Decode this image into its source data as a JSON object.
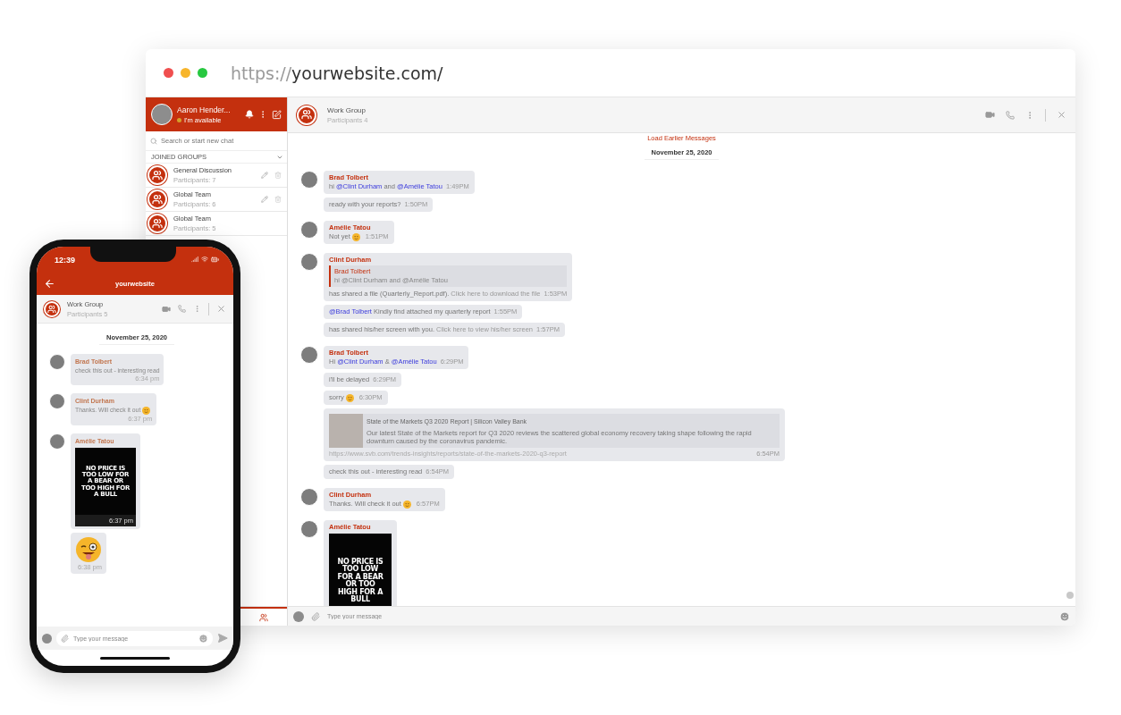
{
  "browser": {
    "url_scheme": "https://",
    "url_host": "yourwebsite.com/"
  },
  "sidebar": {
    "user": {
      "name": "Aaron Hender...",
      "status": "I'm available"
    },
    "search": {
      "placeholder": "Search or start new chat"
    },
    "section": "JOINED GROUPS",
    "groups": [
      {
        "name": "General Discussion",
        "participants": "Participants: 7",
        "editable": true
      },
      {
        "name": "Global Team",
        "participants": "Participants: 6",
        "editable": true
      },
      {
        "name": "Global Team",
        "participants": "Participants: 5",
        "editable": false
      }
    ],
    "tabs": [
      {
        "kind": "contacts",
        "selected": true
      }
    ]
  },
  "chat": {
    "title": "Work Group",
    "participants": "Participants 4",
    "load_more": "Load Earlier Messages",
    "date": "November 25, 2020",
    "messages": [
      {
        "sender": "Brad Tolbert",
        "bubbles": [
          {
            "kind": "text",
            "parts": [
              {
                "kind": "text",
                "text": "hi"
              },
              {
                "kind": "mention",
                "text": "@Clint Durham"
              },
              {
                "kind": "text",
                "text": "and"
              },
              {
                "kind": "mention",
                "text": "@Amélie Tatou"
              }
            ],
            "time": "1:49PM"
          },
          {
            "kind": "text",
            "parts": [
              {
                "kind": "text",
                "text": "ready with your reports?"
              }
            ],
            "time": "1:50PM"
          }
        ]
      },
      {
        "sender": "Amélie Tatou",
        "bubbles": [
          {
            "kind": "text",
            "parts": [
              {
                "kind": "text",
                "text": "Not yet"
              },
              {
                "kind": "emoji"
              }
            ],
            "time": "1:51PM"
          }
        ]
      },
      {
        "sender": "Clint Durham",
        "bubbles": [
          {
            "kind": "quote",
            "quote": {
              "name": "Brad Tolbert",
              "text": "hi @Clint Durham and @Amélie Tatou"
            },
            "parts": [
              {
                "kind": "text",
                "text": "has shared a file (Quarterly_Report.pdf)."
              },
              {
                "kind": "hint",
                "text": "Click here to download the file"
              }
            ],
            "time": "1:53PM"
          },
          {
            "kind": "text",
            "parts": [
              {
                "kind": "mention",
                "text": "@Brad Tolbert"
              },
              {
                "kind": "text",
                "text": "Kindly find attached my quarterly report"
              }
            ],
            "time": "1:55PM"
          },
          {
            "kind": "text",
            "parts": [
              {
                "kind": "text",
                "text": "has shared his/her screen with you."
              },
              {
                "kind": "hint",
                "text": "Click here to view his/her screen"
              }
            ],
            "time": "1:57PM"
          }
        ]
      },
      {
        "sender": "Brad Tolbert",
        "bubbles": [
          {
            "kind": "text",
            "parts": [
              {
                "kind": "text",
                "text": "Hi"
              },
              {
                "kind": "mention",
                "text": "@Clint Durham"
              },
              {
                "kind": "text",
                "text": "&"
              },
              {
                "kind": "mention",
                "text": "@Amélie Tatou"
              }
            ],
            "time": "6:29PM"
          },
          {
            "kind": "text",
            "parts": [
              {
                "kind": "text",
                "text": "i'll be delayed"
              }
            ],
            "time": "6:29PM"
          },
          {
            "kind": "text",
            "parts": [
              {
                "kind": "text",
                "text": "sorry"
              },
              {
                "kind": "emoji"
              }
            ],
            "time": "6:30PM"
          },
          {
            "kind": "preview",
            "title": "State of the Markets Q3 2020 Report | Silicon Valley Bank",
            "description": "Our latest State of the Markets report for Q3 2020 reviews the scattered global economy recovery taking shape following the rapid downturn caused by the coronavirus pandemic.",
            "url": "https://www.svb.com/trends-insights/reports/state-of-the-markets-2020-q3-report",
            "time": "6:54PM"
          },
          {
            "kind": "text",
            "parts": [
              {
                "kind": "text",
                "text": "check this out - interesting read"
              }
            ],
            "time": "6:54PM"
          }
        ]
      },
      {
        "sender": "Clint Durham",
        "bubbles": [
          {
            "kind": "text",
            "parts": [
              {
                "kind": "text",
                "text": "Thanks. Will check it out"
              },
              {
                "kind": "emoji"
              }
            ],
            "time": "6:57PM"
          }
        ]
      },
      {
        "sender": "Amélie Tatou",
        "bubbles": [
          {
            "kind": "image",
            "image_text": "NO PRICE IS TOO LOW FOR A BEAR OR TOO HIGH FOR A BULL"
          }
        ]
      }
    ],
    "composer": {
      "placeholder": "Type your message"
    }
  },
  "phone": {
    "time": "12:39",
    "site": "yourwebsite",
    "title": "Work Group",
    "participants": "Participants 5",
    "date": "November 25, 2020",
    "messages": [
      {
        "sender": "Brad Tolbert",
        "bubbles": [
          {
            "kind": "text",
            "parts": [
              {
                "kind": "text",
                "text": "check this out - interesting read"
              }
            ],
            "time": "6:34 pm"
          }
        ]
      },
      {
        "sender": "Clint Durham",
        "bubbles": [
          {
            "kind": "text",
            "parts": [
              {
                "kind": "text",
                "text": "Thanks. Will check it out"
              },
              {
                "kind": "emoji"
              }
            ],
            "time": "6:37 pm"
          }
        ]
      },
      {
        "sender": "Amélie Tatou",
        "bubbles": [
          {
            "kind": "image",
            "image_text": "NO PRICE IS TOO LOW FOR A BEAR OR TOO HIGH FOR A BULL",
            "time": "6:37 pm"
          },
          {
            "kind": "sticker",
            "time": "6:38 pm"
          }
        ]
      }
    ],
    "composer": {
      "placeholder": "Type your message"
    }
  }
}
